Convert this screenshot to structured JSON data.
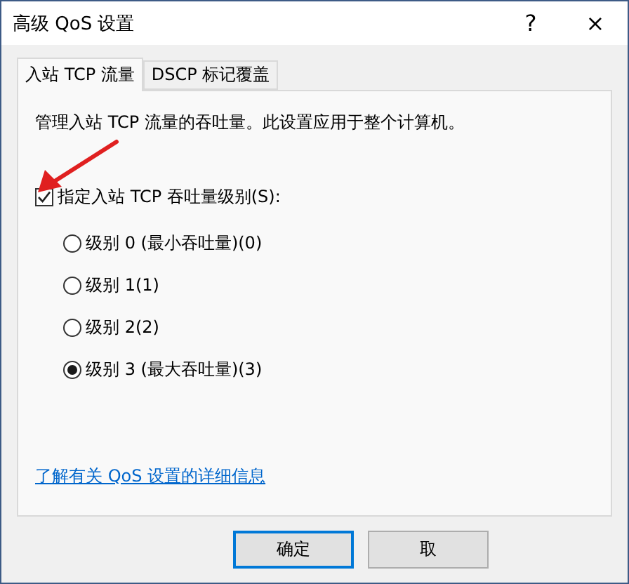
{
  "window": {
    "title": "高级 QoS 设置",
    "help": "?",
    "close": "×"
  },
  "tabs": [
    {
      "label": "入站 TCP 流量",
      "selected": true
    },
    {
      "label": "DSCP 标记覆盖",
      "selected": false
    }
  ],
  "description": "管理入站 TCP 流量的吞吐量。此设置应用于整个计算机。",
  "checkbox": {
    "label": "指定入站 TCP 吞吐量级别(S):",
    "checked": true
  },
  "levels": [
    {
      "label": "级别 0 (最小吞吐量)(0)",
      "selected": false
    },
    {
      "label": "级别 1(1)",
      "selected": false
    },
    {
      "label": "级别 2(2)",
      "selected": false
    },
    {
      "label": "级别 3 (最大吞吐量)(3)",
      "selected": true
    }
  ],
  "link": "了解有关 QoS 设置的详细信息",
  "buttons": [
    {
      "label": "确定",
      "default": true
    },
    {
      "label": "取",
      "default": false
    }
  ]
}
